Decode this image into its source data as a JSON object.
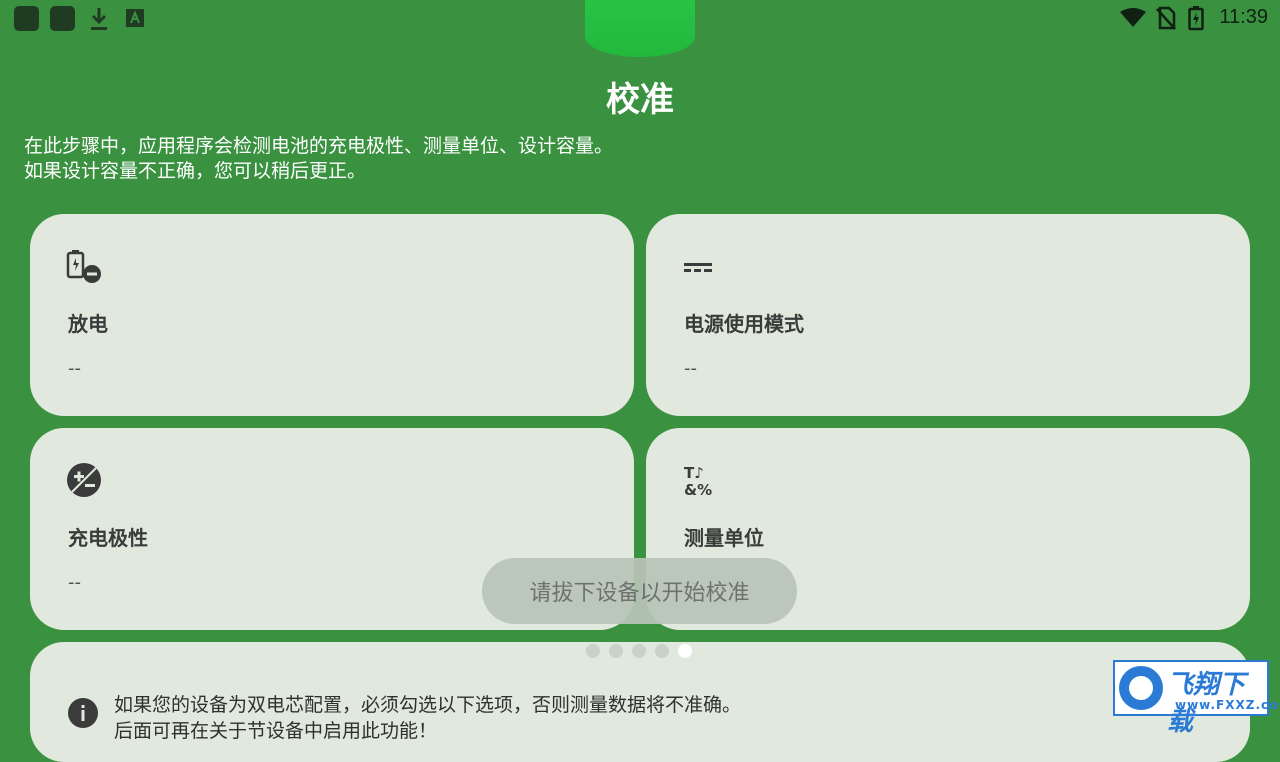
{
  "status_bar": {
    "time": "11:39",
    "left_icons": [
      "app-icon",
      "app-icon",
      "download-icon",
      "keyboard-a-icon"
    ],
    "right_icons": [
      "wifi-icon",
      "no-sim-icon",
      "battery-charging-icon"
    ]
  },
  "page": {
    "title": "校准",
    "intro_line1": "在此步骤中，应用程序会检测电池的充电极性、测量单位、设计容量。",
    "intro_line2": "如果设计容量不正确，您可以稍后更正。"
  },
  "cards": [
    {
      "icon": "battery-minus-icon",
      "title": "放电",
      "value": "--"
    },
    {
      "icon": "dc-power-icon",
      "title": "电源使用模式",
      "value": "--"
    },
    {
      "icon": "plus-minus-circle-icon",
      "title": "充电极性",
      "value": "--"
    },
    {
      "icon": "units-symbols-icon",
      "title": "测量单位",
      "value": "--"
    }
  ],
  "info_card": {
    "line1": "如果您的设备为双电芯配置，必须勾选以下选项，否则测量数据将不准确。",
    "line2": "后面可再在关于节设备中启用此功能！"
  },
  "pager": {
    "count": 5,
    "active": 5
  },
  "toast": "请拔下设备以开始校准",
  "watermark": {
    "main": "飞翔下载",
    "sub": "www.FXXZ.com"
  },
  "colors": {
    "background": "#3a9140",
    "card": "#e1e8dd",
    "accent_green": "#2fd04e"
  }
}
